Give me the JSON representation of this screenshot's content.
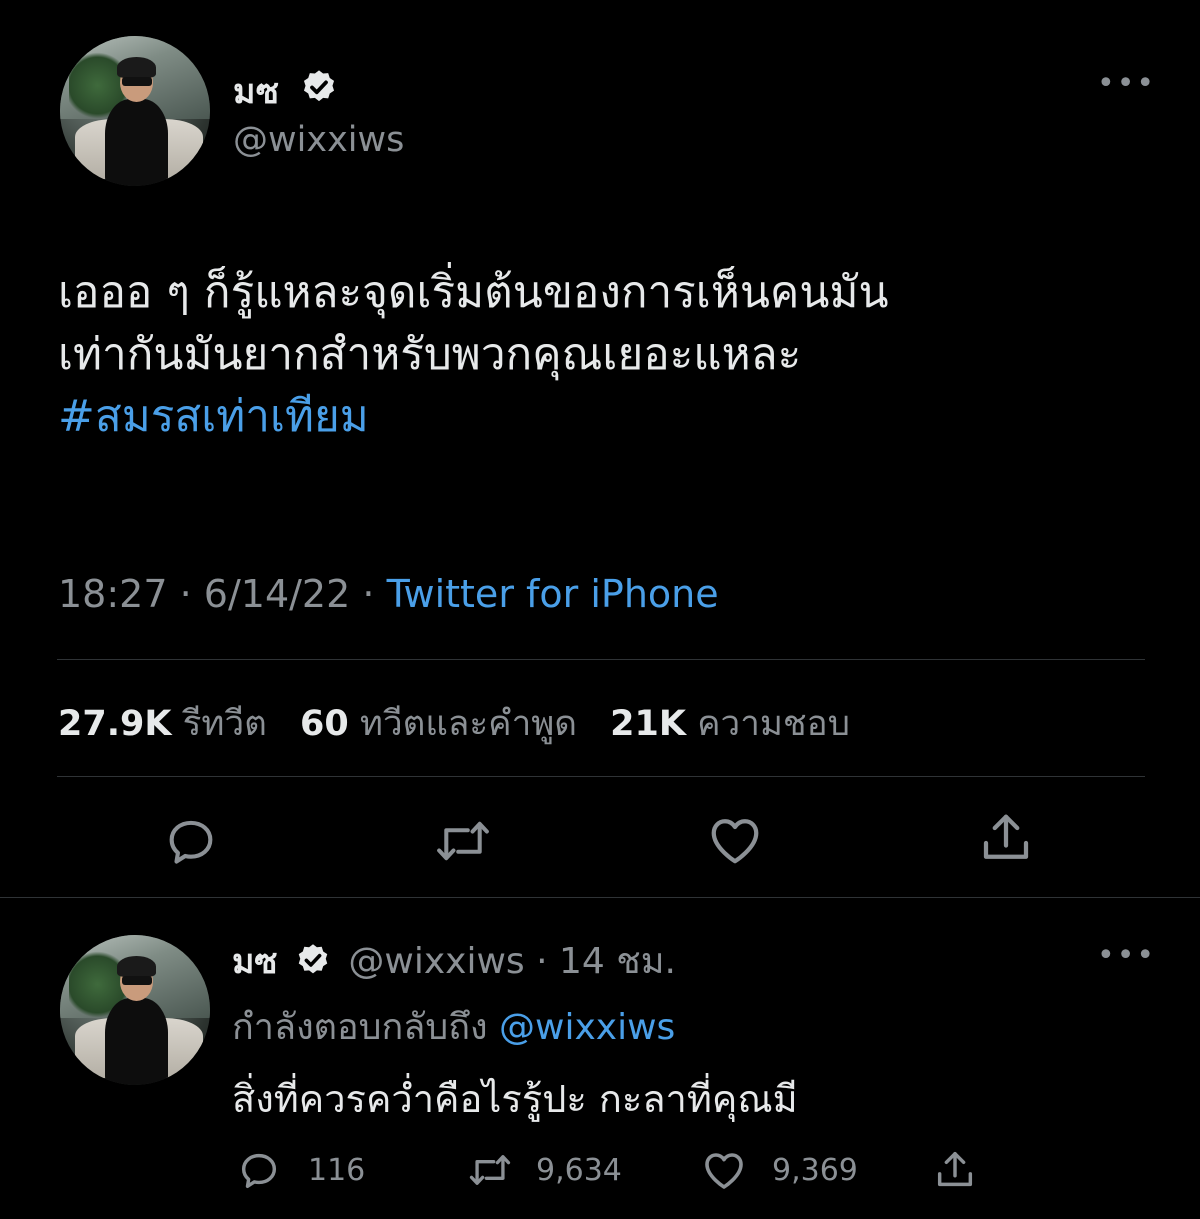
{
  "tweet": {
    "display_name": "มซ",
    "handle": "@wixxiws",
    "more_label": "•••",
    "text_line1": "เอออ ๆ  ก็รู้แหละจุดเริ่มต้นของการเห็นคนมัน",
    "text_line2": "เท่ากันมันยากสำหรับพวกคุณเยอะแหละ",
    "hashtag": "#สมรสเท่าเทียม",
    "time": "18:27",
    "date": "6/14/22",
    "meta_sep": "·",
    "source": "Twitter for iPhone",
    "stats": {
      "retweets_count": "27.9K",
      "retweets_label": "รีทวีต",
      "quotes_count": "60",
      "quotes_label": "ทวีตและคำพูด",
      "likes_count": "21K",
      "likes_label": "ความชอบ"
    },
    "actions": [
      "reply-icon",
      "retweet-icon",
      "like-icon",
      "share-icon"
    ]
  },
  "reply": {
    "display_name": "มซ",
    "handle": "@wixxiws",
    "sep": "·",
    "time_ago": "14 ชม.",
    "more_label": "•••",
    "replying_to_label": "กำลังตอบกลับถึง",
    "replying_to_handle": "@wixxiws",
    "text": "สิ่งที่ควรคว่ำคือไรรู้ปะ กะลาที่คุณมี",
    "reply_count": "116",
    "retweet_count": "9,634",
    "like_count": "9,369"
  },
  "colors": {
    "background": "#000000",
    "text_primary": "#e7e9ea",
    "text_secondary": "#8b9095",
    "link": "#4a9fe8",
    "divider": "#2f3336"
  }
}
